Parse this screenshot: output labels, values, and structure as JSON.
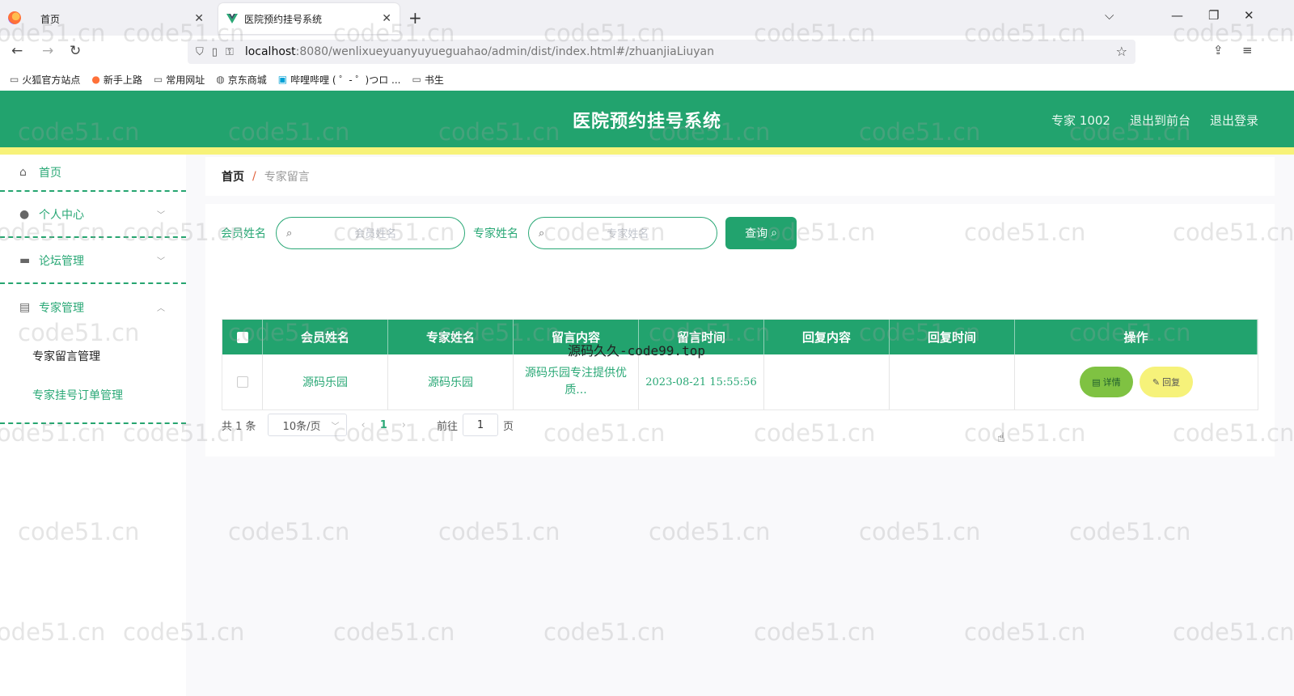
{
  "browser": {
    "tabs": [
      {
        "label": "首页",
        "active": false
      },
      {
        "label": "医院预约挂号系统",
        "active": true
      }
    ],
    "url_host": "localhost",
    "url_rest": ":8080/wenlixueyuanyuyueguahao/admin/dist/index.html#/zhuanjiaLiuyan",
    "bookmarks": [
      "火狐官方站点",
      "新手上路",
      "常用网址",
      "京东商城",
      "哔哩哔哩 ( ゜- ゜)つロ ...",
      "书生"
    ]
  },
  "header": {
    "title": "医院预约挂号系统",
    "links": [
      "专家 1002",
      "退出到前台",
      "退出登录"
    ]
  },
  "sidebar": {
    "items": [
      {
        "label": "首页",
        "icon": "home-icon"
      },
      {
        "label": "个人中心",
        "icon": "user-icon"
      },
      {
        "label": "论坛管理",
        "icon": "monitor-icon"
      },
      {
        "label": "专家管理",
        "icon": "clipboard-icon"
      }
    ],
    "subitems": [
      "专家留言管理",
      "专家挂号订单管理"
    ]
  },
  "breadcrumb": {
    "home": "首页",
    "separator": "/",
    "current": "专家留言"
  },
  "search": {
    "label_member": "会员姓名",
    "placeholder_member": "会员姓名",
    "label_expert": "专家姓名",
    "placeholder_expert": "专家姓名",
    "query_label": "查询"
  },
  "table": {
    "headers": [
      "会员姓名",
      "专家姓名",
      "留言内容",
      "留言时间",
      "回复内容",
      "回复时间",
      "操作"
    ],
    "rows": [
      {
        "member": "源码乐园",
        "expert": "源码乐园",
        "content": "源码乐园专注提供优质...",
        "time": "2023-08-21 15:55:56",
        "reply": "",
        "reply_time": "",
        "detail_label": "详情",
        "reply_label": "回复"
      }
    ]
  },
  "pager": {
    "total": "共 1 条",
    "size": "10条/页",
    "current": "1",
    "goto_prefix": "前往",
    "goto_value": "1",
    "goto_suffix": "页"
  },
  "overlay_text": "源码久久-code99.top",
  "watermark": "code51.cn",
  "colors": {
    "primary": "#22a36e",
    "stripe": "#f7f279",
    "detail": "#7fc242",
    "reply": "#f6f27a"
  }
}
